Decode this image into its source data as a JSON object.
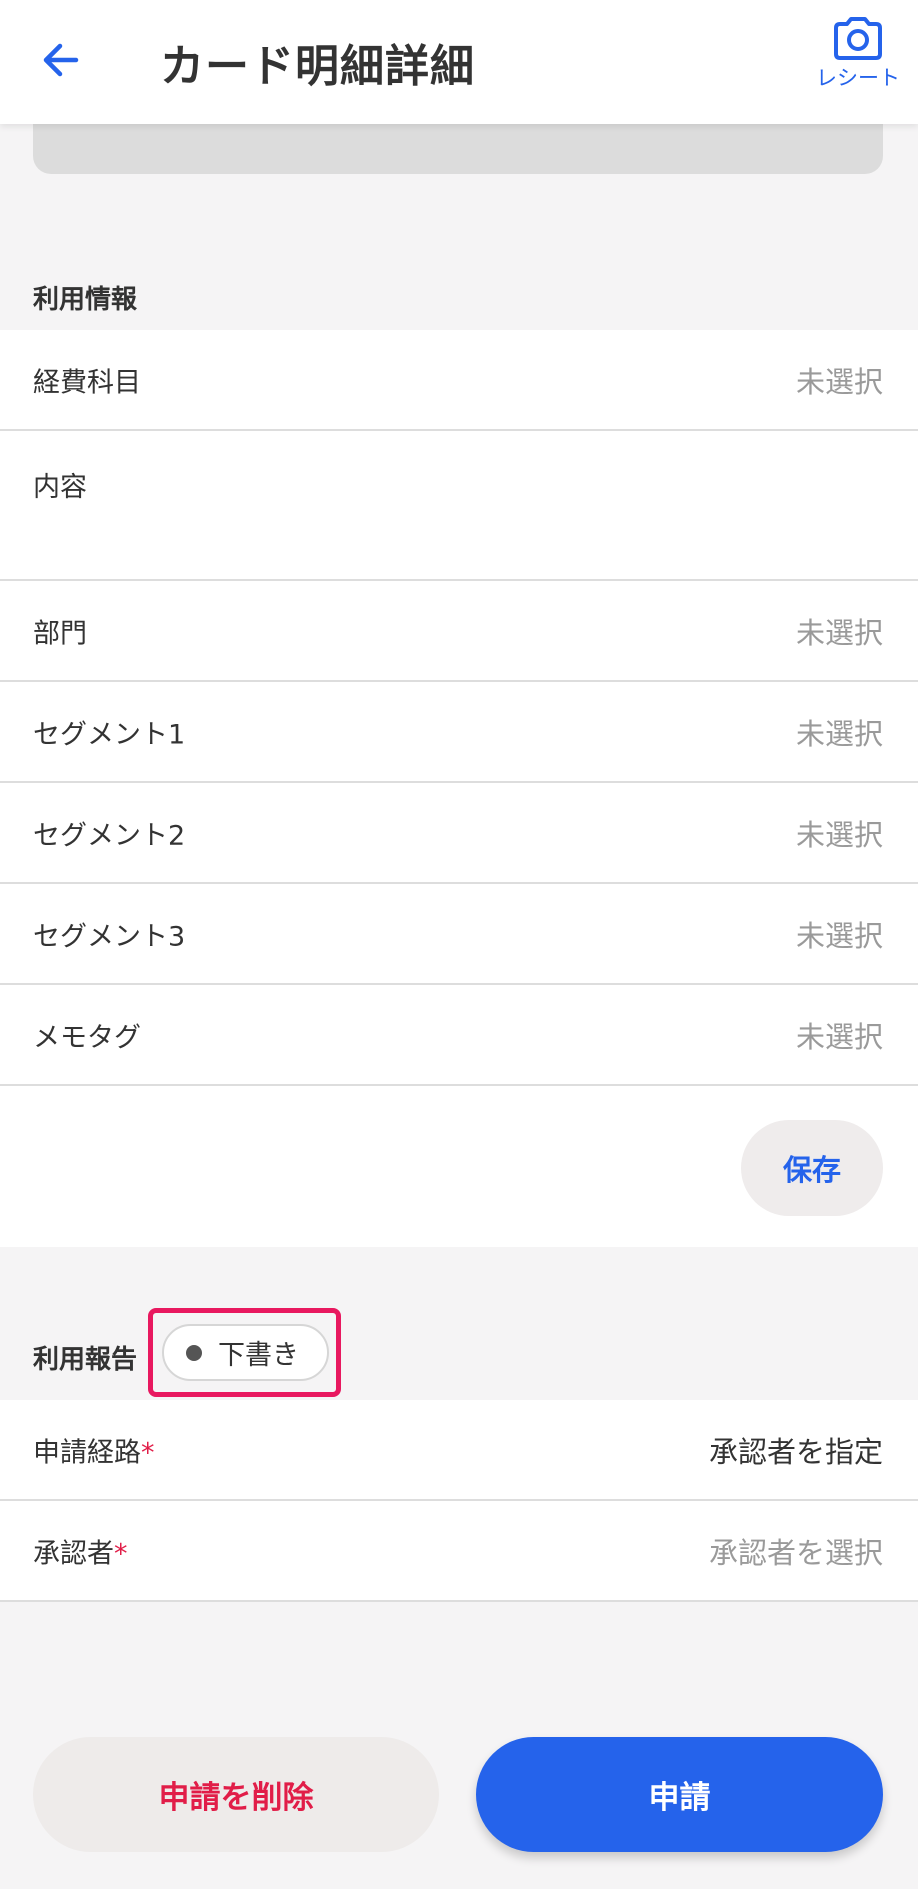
{
  "header": {
    "title": "カード明細詳細",
    "receipt_label": "レシート",
    "back_icon": "arrow-left-icon",
    "receipt_icon": "camera-icon"
  },
  "usage_info": {
    "section_title": "利用情報",
    "rows": [
      {
        "label": "経費科目",
        "value": "未選択"
      },
      {
        "label": "内容",
        "value": ""
      },
      {
        "label": "部門",
        "value": "未選択"
      },
      {
        "label": "セグメント1",
        "value": "未選択"
      },
      {
        "label": "セグメント2",
        "value": "未選択"
      },
      {
        "label": "セグメント3",
        "value": "未選択"
      },
      {
        "label": "メモタグ",
        "value": "未選択"
      }
    ],
    "save_label": "保存"
  },
  "usage_report": {
    "section_title": "利用報告",
    "status": "下書き",
    "route_label": "申請経路",
    "route_value": "承認者を指定",
    "approver_label": "承認者",
    "approver_value": "承認者を選択",
    "required_mark": "*"
  },
  "actions": {
    "delete_label": "申請を削除",
    "apply_label": "申請"
  },
  "colors": {
    "accent": "#2563eb",
    "danger": "#e11d48",
    "highlight": "#e8185f"
  }
}
